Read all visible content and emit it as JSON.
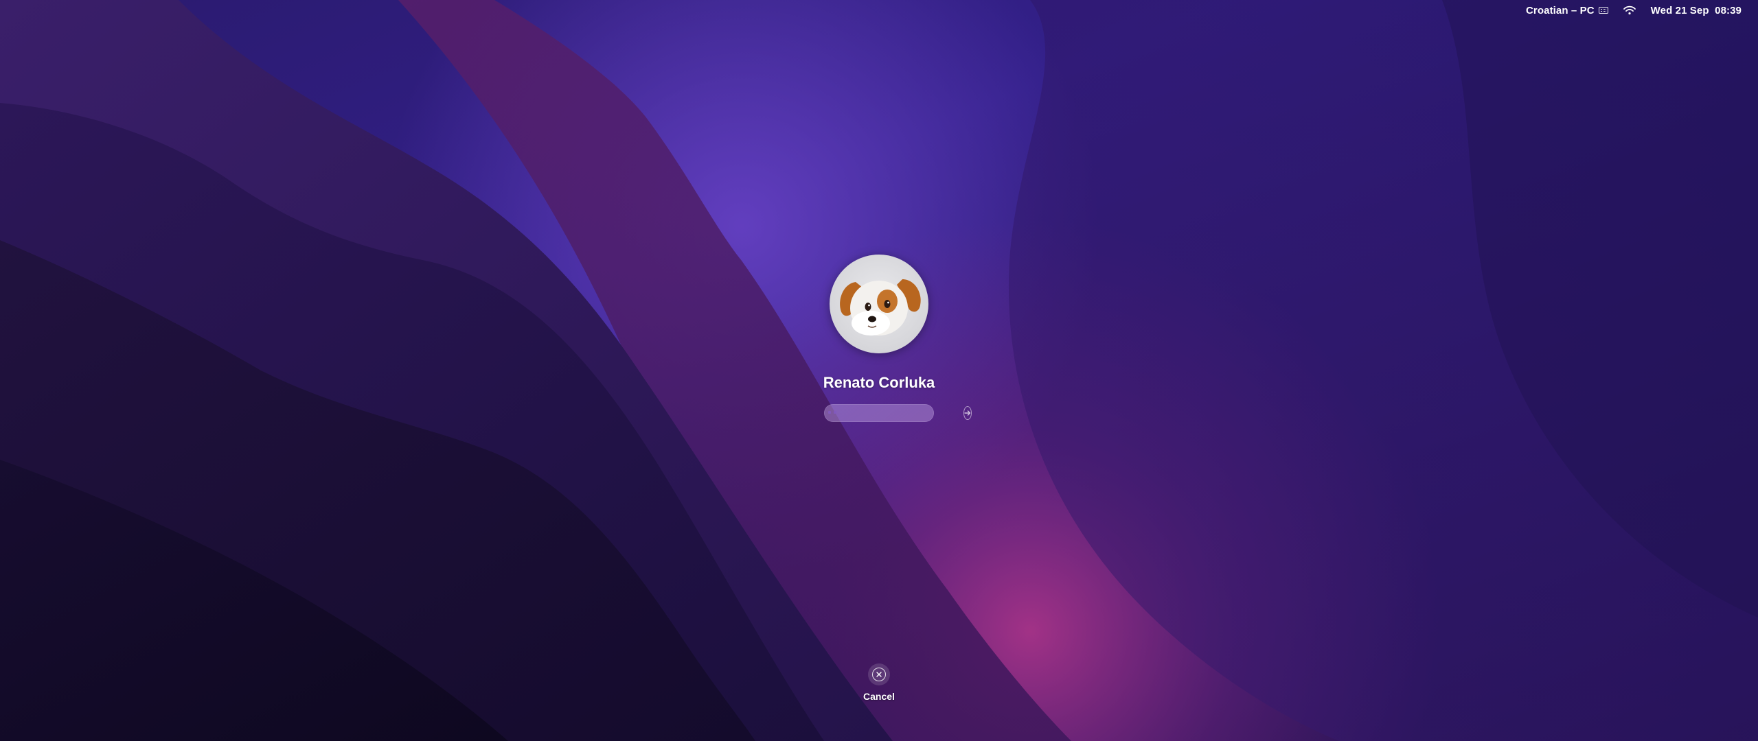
{
  "menubar": {
    "keyboard_layout": "Croatian – PC",
    "keyboard_icon": "keyboard-icon",
    "wifi_icon": "wifi-icon",
    "datetime": "Wed 21 Sep  08:39"
  },
  "login": {
    "avatar_icon": "dog-memoji-avatar",
    "user_name": "Renato Corluka",
    "password_placeholder": "",
    "submit_icon": "arrow-right-circle-icon"
  },
  "cancel": {
    "label": "Cancel",
    "icon": "x-circle-icon"
  },
  "colors": {
    "wallpaper_dark": "#120c26",
    "wallpaper_mid": "#3a1a6e",
    "wallpaper_accent": "#8a2f8f",
    "text": "#ffffff"
  }
}
